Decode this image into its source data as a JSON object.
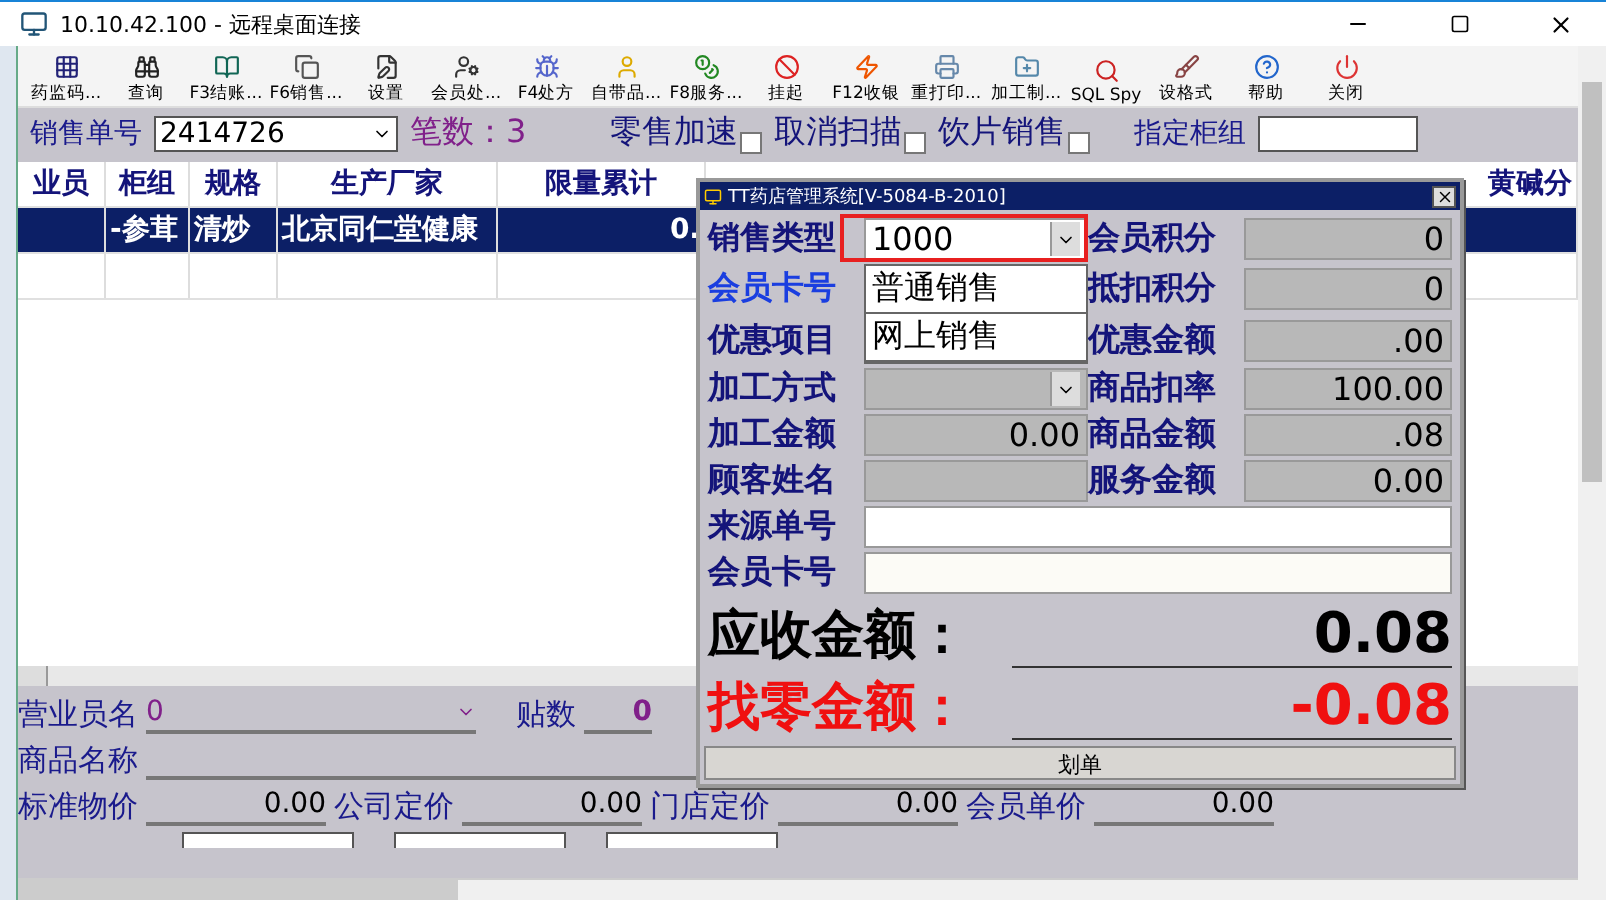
{
  "window": {
    "title": "10.10.42.100 - 远程桌面连接"
  },
  "toolbar": [
    {
      "label": "药监码..."
    },
    {
      "label": "查询"
    },
    {
      "label": "F3结账..."
    },
    {
      "label": "F6销售..."
    },
    {
      "label": "设置"
    },
    {
      "label": "会员处..."
    },
    {
      "label": "F4处方"
    },
    {
      "label": "自带品..."
    },
    {
      "label": "F8服务..."
    },
    {
      "label": "挂起"
    },
    {
      "label": "F12收银"
    },
    {
      "label": "重打印..."
    },
    {
      "label": "加工制..."
    },
    {
      "label": "SQL Spy"
    },
    {
      "label": "设格式"
    },
    {
      "label": "帮助"
    },
    {
      "label": "关闭"
    }
  ],
  "order_bar": {
    "order_label": "销售单号",
    "order_value": "2414726",
    "count": "笔数：3",
    "options": [
      {
        "label": "零售加速",
        "checked": false
      },
      {
        "label": "取消扫描",
        "checked": false
      },
      {
        "label": "饮片销售",
        "checked": false
      }
    ],
    "counter_label": "指定柜组"
  },
  "table": {
    "columns": [
      "业员",
      "柜组",
      "规格",
      "生产厂家",
      "限量累计",
      "黄碱分"
    ],
    "rows": [
      {
        "cells": [
          "",
          "-参茸",
          "清炒",
          "北京同仁堂健康",
          "0.",
          ""
        ],
        "selected": true
      },
      {
        "cells": [
          "",
          "",
          "",
          "",
          "",
          ""
        ],
        "selected": false
      }
    ]
  },
  "form": {
    "clerk_label": "营业员名",
    "clerk_value": "0",
    "packs_label": "贴数",
    "packs_value": "0",
    "name_label": "商品名称",
    "prices": [
      {
        "label": "标准物价",
        "value": "0.00"
      },
      {
        "label": "公司定价",
        "value": "0.00"
      },
      {
        "label": "门店定价",
        "value": "0.00"
      },
      {
        "label": "会员单价",
        "value": "0.00"
      }
    ]
  },
  "dialog": {
    "title": "TT药店管理系统[V-5084-B-2010]",
    "sale_type": {
      "label": "销售类型",
      "value": "1000",
      "options": [
        "普通销售",
        "网上销售"
      ]
    },
    "left": [
      {
        "label": "会员卡号",
        "kind": "list"
      },
      {
        "label": "优惠项目",
        "kind": "list"
      },
      {
        "label": "加工方式",
        "kind": "combo"
      },
      {
        "label": "加工金额",
        "kind": "field",
        "value": "0.00"
      },
      {
        "label": "顾客姓名",
        "kind": "field"
      }
    ],
    "right": [
      {
        "label": "会员积分",
        "value": "0"
      },
      {
        "label": "抵扣积分",
        "value": "0"
      },
      {
        "label": "优惠金额",
        "value": ".00"
      },
      {
        "label": "商品扣率",
        "value": "100.00"
      },
      {
        "label": "商品金额",
        "value": ".08"
      },
      {
        "label": "服务金额",
        "value": "0.00"
      }
    ],
    "wide": [
      {
        "label": "来源单号"
      },
      {
        "label": "会员卡号"
      }
    ],
    "receivable": {
      "label": "应收金额：",
      "value": "0.08"
    },
    "change": {
      "label": "找零金额：",
      "value": "-0.08"
    },
    "button": "划单"
  }
}
